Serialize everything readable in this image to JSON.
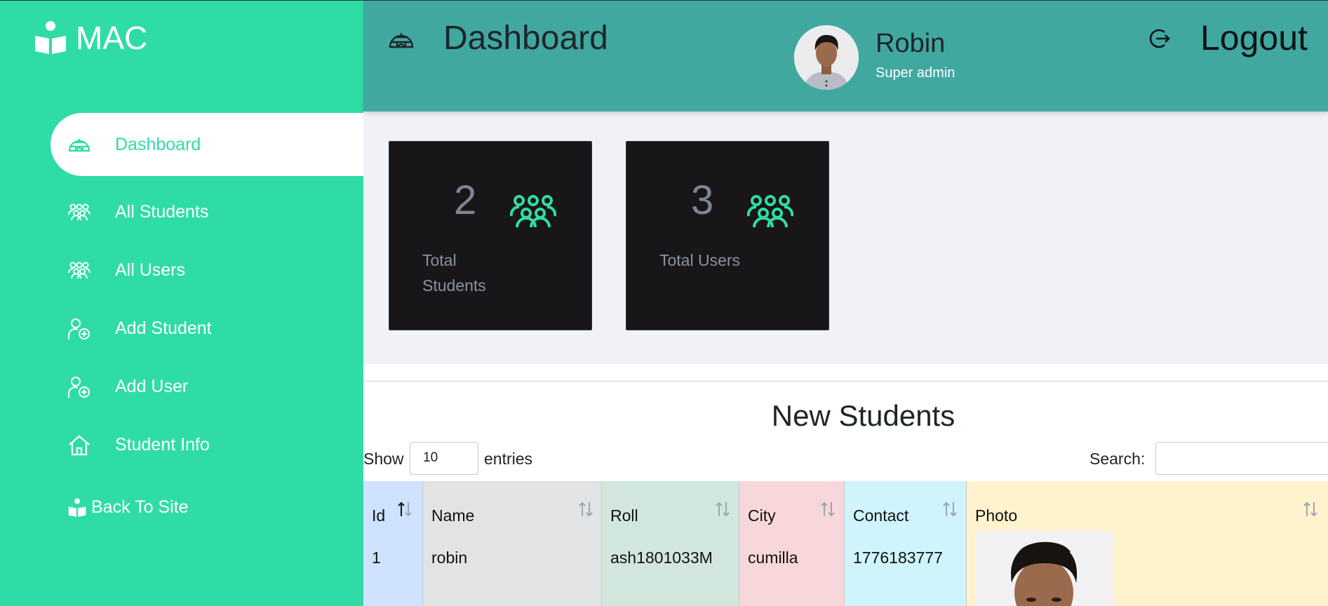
{
  "brand": {
    "name": "MAC",
    "icon": "book-reader-icon"
  },
  "sidebar": {
    "items": [
      {
        "label": "Dashboard",
        "icon": "igloo-icon",
        "active": true
      },
      {
        "label": "All Students",
        "icon": "group-icon"
      },
      {
        "label": "All Users",
        "icon": "group-icon"
      },
      {
        "label": "Add Student",
        "icon": "user-plus-icon"
      },
      {
        "label": "Add User",
        "icon": "user-plus-icon"
      },
      {
        "label": "Student Info",
        "icon": "home-icon"
      }
    ],
    "back_to_site": "Back To Site"
  },
  "header": {
    "title": "Dashboard",
    "user_name": "Robin",
    "user_role": "Super admin",
    "logout_label": "Logout"
  },
  "stats": [
    {
      "value": "2",
      "label": "Total Students"
    },
    {
      "value": "3",
      "label": "Total Users"
    }
  ],
  "students_section": {
    "title": "New Students",
    "show_label": "Show",
    "page_length": "10",
    "entries_label": "entries",
    "search_label": "Search:",
    "columns": [
      "Id",
      "Name",
      "Roll",
      "City",
      "Contact",
      "Photo"
    ],
    "rows": [
      {
        "id": "1",
        "name": "robin",
        "roll": "ash1801033M",
        "city": "cumilla",
        "contact": "1776183777"
      }
    ]
  },
  "colors": {
    "sidebar": "#30dca6",
    "topbar": "#41a8a0",
    "card": "#181618",
    "col_id": "#cfe2ff",
    "col_name": "#e2e3e5",
    "col_roll": "#d1e7dd",
    "col_city": "#f8d7da",
    "col_contact": "#cff4fc",
    "col_photo": "#fff3cd"
  }
}
